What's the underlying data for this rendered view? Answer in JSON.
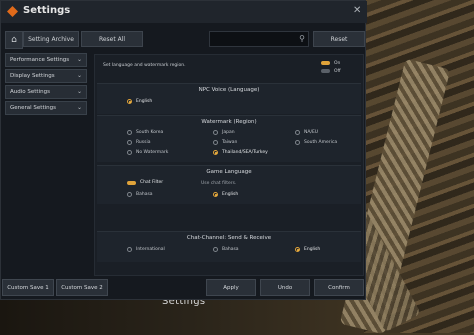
{
  "window": {
    "title": "Settings",
    "close_glyph": "✕"
  },
  "toolbar": {
    "home_glyph": "⌂",
    "archive_label": "Setting Archive",
    "reset_all_label": "Reset All",
    "search_placeholder": "",
    "search_glyph": "⚲",
    "reset_label": "Reset"
  },
  "sidebar": {
    "items": [
      {
        "label": "Performance Settings"
      },
      {
        "label": "Display Settings"
      },
      {
        "label": "Audio Settings"
      },
      {
        "label": "General Settings"
      }
    ],
    "chevron": "⌄"
  },
  "panel": {
    "description": "Set language and watermark region.",
    "legend": {
      "on_label": "On",
      "off_label": "Off",
      "on_color": "#e0a33a",
      "off_color": "#5a6068"
    },
    "npc_voice": {
      "title": "NPC Voice (Language)",
      "options": [
        "English"
      ],
      "selected": "English"
    },
    "watermark": {
      "title": "Watermark (Region)",
      "options": [
        "South Korea",
        "Japan",
        "NA/EU",
        "Russia",
        "Taiwan",
        "South America",
        "No Watermark",
        "Thailand/SEA/Turkey"
      ],
      "selected": "Thailand/SEA/Turkey"
    },
    "game_language": {
      "title": "Game Language",
      "chat_filter_label": "Chat Filter",
      "chat_filter_hint": "Use chat filters.",
      "options": [
        "Bahasa",
        "English"
      ],
      "selected": "English"
    },
    "chat_channel": {
      "title": "Chat-Channel: Send & Receive",
      "options": [
        "International",
        "Bahasa",
        "English"
      ],
      "selected": "English"
    }
  },
  "footer": {
    "custom_save_1": "Custom Save 1",
    "custom_save_2": "Custom Save 2",
    "apply": "Apply",
    "undo": "Undo",
    "confirm": "Confirm"
  },
  "background": {
    "caption": "Settings"
  }
}
